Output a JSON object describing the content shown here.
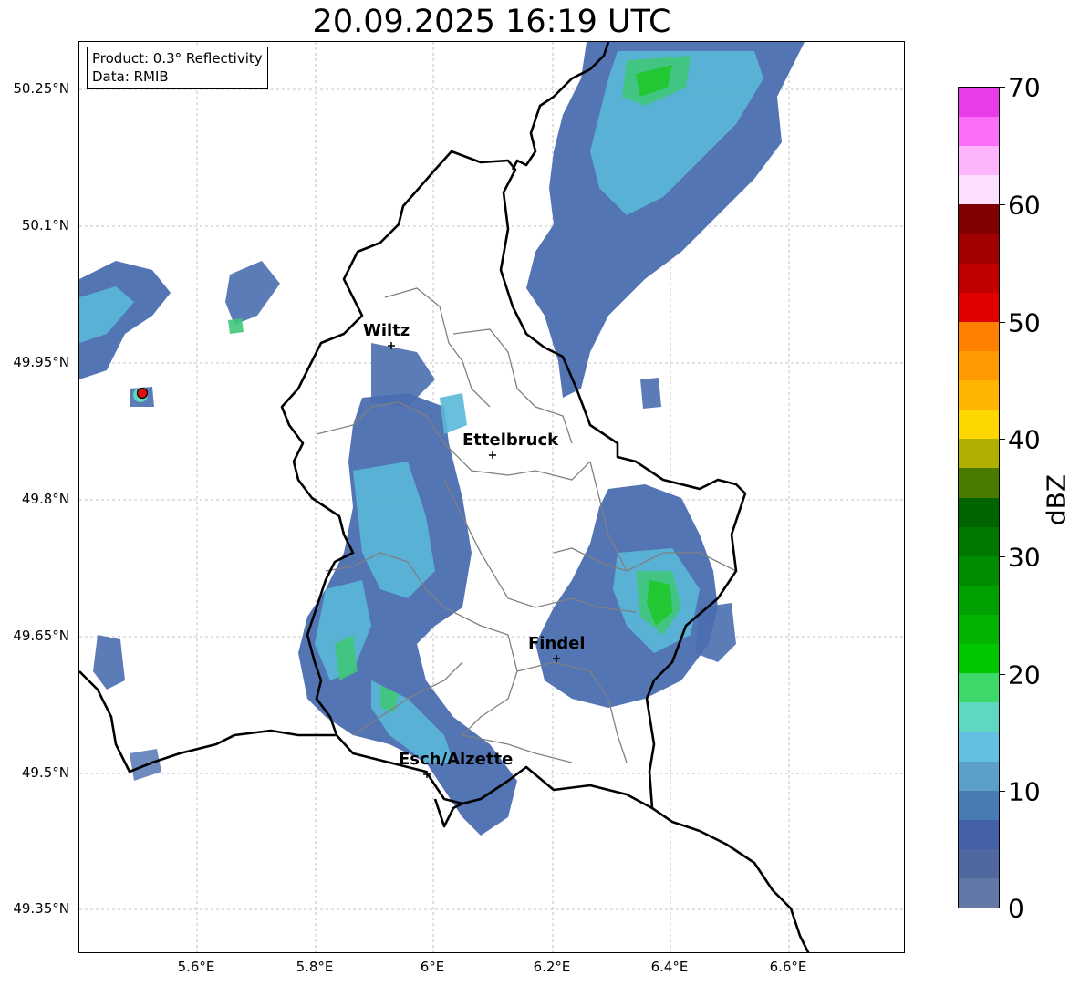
{
  "title": "20.09.2025 16:19 UTC",
  "info": {
    "product": "Product: 0.3° Reflectivity",
    "source": "Data: RMIB"
  },
  "lat_labels": [
    "50.25°N",
    "50.1°N",
    "49.95°N",
    "49.8°N",
    "49.65°N",
    "49.5°N",
    "49.35°N"
  ],
  "lon_labels": [
    "5.6°E",
    "5.8°E",
    "6°E",
    "6.2°E",
    "6.4°E",
    "6.6°E"
  ],
  "cities": [
    {
      "name": "Wiltz"
    },
    {
      "name": "Ettelbruck"
    },
    {
      "name": "Findel"
    },
    {
      "name": "Esch/Alzette"
    }
  ],
  "colorbar": {
    "unit": "dBZ",
    "ticks": [
      "70",
      "60",
      "50",
      "40",
      "30",
      "20",
      "10",
      "0"
    ],
    "colors": [
      "#e83ce8",
      "#fa6ef8",
      "#fcb4fc",
      "#fde0fd",
      "#800000",
      "#a00000",
      "#c00000",
      "#e00000",
      "#ff7f00",
      "#ff9a00",
      "#ffb400",
      "#ffd700",
      "#b0b000",
      "#4a7a00",
      "#006400",
      "#007800",
      "#008c00",
      "#00a000",
      "#00b400",
      "#00c800",
      "#3dd86a",
      "#5ed8c0",
      "#64c0e0",
      "#5aa0c8",
      "#4a7ab4",
      "#4460a8",
      "#5068a0",
      "#6478a8"
    ]
  }
}
